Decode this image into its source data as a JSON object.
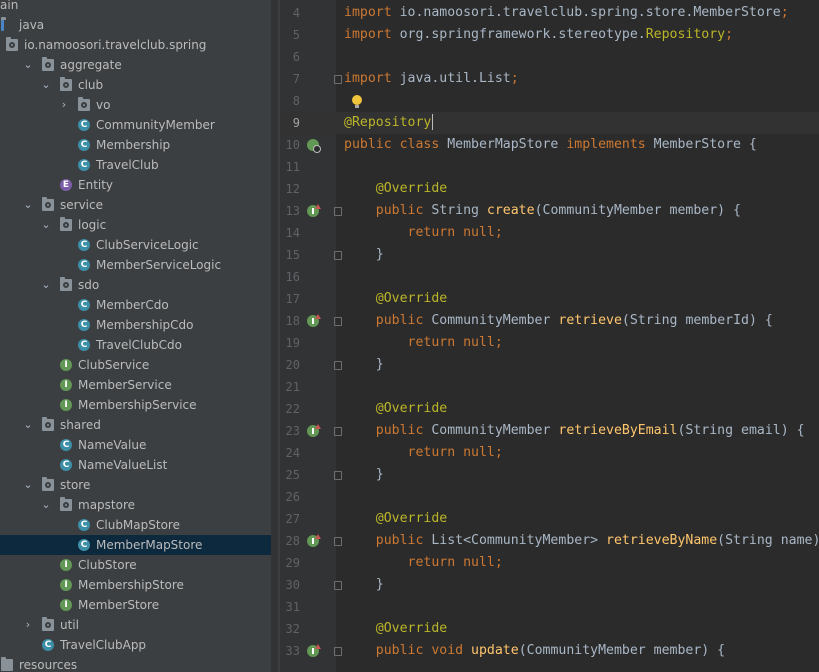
{
  "tree": [
    {
      "label": "ain",
      "depth": 0,
      "arrow": "",
      "icon": ""
    },
    {
      "label": "java",
      "depth": 0,
      "arrow": "",
      "icon": "folder-blue"
    },
    {
      "label": "io.namoosori.travelclub.spring",
      "depth": 0,
      "arrow": "",
      "icon": "package"
    },
    {
      "label": "aggregate",
      "depth": 1,
      "arrow": "down",
      "icon": "package"
    },
    {
      "label": "club",
      "depth": 2,
      "arrow": "down",
      "icon": "package"
    },
    {
      "label": "vo",
      "depth": 3,
      "arrow": "right",
      "icon": "package"
    },
    {
      "label": "CommunityMember",
      "depth": 3,
      "arrow": "",
      "icon": "class"
    },
    {
      "label": "Membership",
      "depth": 3,
      "arrow": "",
      "icon": "class"
    },
    {
      "label": "TravelClub",
      "depth": 3,
      "arrow": "",
      "icon": "class"
    },
    {
      "label": "Entity",
      "depth": 2,
      "arrow": "",
      "icon": "interface-e"
    },
    {
      "label": "service",
      "depth": 1,
      "arrow": "down",
      "icon": "package"
    },
    {
      "label": "logic",
      "depth": 2,
      "arrow": "down",
      "icon": "package"
    },
    {
      "label": "ClubServiceLogic",
      "depth": 3,
      "arrow": "",
      "icon": "class"
    },
    {
      "label": "MemberServiceLogic",
      "depth": 3,
      "arrow": "",
      "icon": "class"
    },
    {
      "label": "sdo",
      "depth": 2,
      "arrow": "down",
      "icon": "package"
    },
    {
      "label": "MemberCdo",
      "depth": 3,
      "arrow": "",
      "icon": "class"
    },
    {
      "label": "MembershipCdo",
      "depth": 3,
      "arrow": "",
      "icon": "class"
    },
    {
      "label": "TravelClubCdo",
      "depth": 3,
      "arrow": "",
      "icon": "class"
    },
    {
      "label": "ClubService",
      "depth": 2,
      "arrow": "",
      "icon": "interface"
    },
    {
      "label": "MemberService",
      "depth": 2,
      "arrow": "",
      "icon": "interface"
    },
    {
      "label": "MembershipService",
      "depth": 2,
      "arrow": "",
      "icon": "interface"
    },
    {
      "label": "shared",
      "depth": 1,
      "arrow": "down",
      "icon": "package"
    },
    {
      "label": "NameValue",
      "depth": 2,
      "arrow": "",
      "icon": "class"
    },
    {
      "label": "NameValueList",
      "depth": 2,
      "arrow": "",
      "icon": "class"
    },
    {
      "label": "store",
      "depth": 1,
      "arrow": "down",
      "icon": "package"
    },
    {
      "label": "mapstore",
      "depth": 2,
      "arrow": "down",
      "icon": "package"
    },
    {
      "label": "ClubMapStore",
      "depth": 3,
      "arrow": "",
      "icon": "class"
    },
    {
      "label": "MemberMapStore",
      "depth": 3,
      "arrow": "",
      "icon": "class",
      "selected": true
    },
    {
      "label": "ClubStore",
      "depth": 2,
      "arrow": "",
      "icon": "interface"
    },
    {
      "label": "MembershipStore",
      "depth": 2,
      "arrow": "",
      "icon": "interface"
    },
    {
      "label": "MemberStore",
      "depth": 2,
      "arrow": "",
      "icon": "interface"
    },
    {
      "label": "util",
      "depth": 1,
      "arrow": "right",
      "icon": "package"
    },
    {
      "label": "TravelClubApp",
      "depth": 1,
      "arrow": "",
      "icon": "class"
    },
    {
      "label": "resources",
      "depth": 0,
      "arrow": "",
      "icon": "folder"
    }
  ],
  "editor": {
    "current_line": "9",
    "lines": [
      {
        "n": "4",
        "seg": [
          [
            "kw",
            "import "
          ],
          [
            "pl",
            "io.namoosori.travelclub.spring.store.MemberStore"
          ],
          [
            "kw",
            ";"
          ]
        ]
      },
      {
        "n": "5",
        "seg": [
          [
            "kw",
            "import "
          ],
          [
            "pl",
            "org.springframework.stereotype."
          ],
          [
            "an",
            "Repository"
          ],
          [
            "kw",
            ";"
          ]
        ]
      },
      {
        "n": "6",
        "seg": []
      },
      {
        "n": "7",
        "seg": [
          [
            "kw",
            "import "
          ],
          [
            "pl",
            "java.util.List"
          ],
          [
            "kw",
            ";"
          ]
        ],
        "fold": true
      },
      {
        "n": "8",
        "seg": []
      },
      {
        "n": "9",
        "seg": [
          [
            "an",
            "@Repository"
          ]
        ],
        "caret": true
      },
      {
        "n": "10",
        "seg": [
          [
            "kw",
            "public class "
          ],
          [
            "pl",
            "MemberMapStore "
          ],
          [
            "kw",
            "implements "
          ],
          [
            "pl",
            "MemberStore {"
          ]
        ],
        "marker": "bean"
      },
      {
        "n": "11",
        "seg": []
      },
      {
        "n": "12",
        "seg": [
          [
            "pl",
            "    "
          ],
          [
            "an",
            "@Override"
          ]
        ]
      },
      {
        "n": "13",
        "seg": [
          [
            "pl",
            "    "
          ],
          [
            "kw",
            "public "
          ],
          [
            "pl",
            "String "
          ],
          [
            "fn",
            "create"
          ],
          [
            "pl",
            "(CommunityMember member) {"
          ]
        ],
        "marker": "override",
        "fold": true
      },
      {
        "n": "14",
        "seg": [
          [
            "pl",
            "        "
          ],
          [
            "kw",
            "return null;"
          ]
        ]
      },
      {
        "n": "15",
        "seg": [
          [
            "pl",
            "    }"
          ]
        ],
        "fold": true
      },
      {
        "n": "16",
        "seg": []
      },
      {
        "n": "17",
        "seg": [
          [
            "pl",
            "    "
          ],
          [
            "an",
            "@Override"
          ]
        ]
      },
      {
        "n": "18",
        "seg": [
          [
            "pl",
            "    "
          ],
          [
            "kw",
            "public "
          ],
          [
            "pl",
            "CommunityMember "
          ],
          [
            "fn",
            "retrieve"
          ],
          [
            "pl",
            "(String memberId) {"
          ]
        ],
        "marker": "override",
        "fold": true
      },
      {
        "n": "19",
        "seg": [
          [
            "pl",
            "        "
          ],
          [
            "kw",
            "return null;"
          ]
        ]
      },
      {
        "n": "20",
        "seg": [
          [
            "pl",
            "    }"
          ]
        ],
        "fold": true
      },
      {
        "n": "21",
        "seg": []
      },
      {
        "n": "22",
        "seg": [
          [
            "pl",
            "    "
          ],
          [
            "an",
            "@Override"
          ]
        ]
      },
      {
        "n": "23",
        "seg": [
          [
            "pl",
            "    "
          ],
          [
            "kw",
            "public "
          ],
          [
            "pl",
            "CommunityMember "
          ],
          [
            "fn",
            "retrieveByEmail"
          ],
          [
            "pl",
            "(String email) {"
          ]
        ],
        "marker": "override",
        "fold": true
      },
      {
        "n": "24",
        "seg": [
          [
            "pl",
            "        "
          ],
          [
            "kw",
            "return null;"
          ]
        ]
      },
      {
        "n": "25",
        "seg": [
          [
            "pl",
            "    }"
          ]
        ],
        "fold": true
      },
      {
        "n": "26",
        "seg": []
      },
      {
        "n": "27",
        "seg": [
          [
            "pl",
            "    "
          ],
          [
            "an",
            "@Override"
          ]
        ]
      },
      {
        "n": "28",
        "seg": [
          [
            "pl",
            "    "
          ],
          [
            "kw",
            "public "
          ],
          [
            "pl",
            "List<CommunityMember> "
          ],
          [
            "fn",
            "retrieveByName"
          ],
          [
            "pl",
            "(String name)"
          ]
        ],
        "marker": "override",
        "fold": true
      },
      {
        "n": "29",
        "seg": [
          [
            "pl",
            "        "
          ],
          [
            "kw",
            "return null;"
          ]
        ]
      },
      {
        "n": "30",
        "seg": [
          [
            "pl",
            "    }"
          ]
        ],
        "fold": true
      },
      {
        "n": "31",
        "seg": []
      },
      {
        "n": "32",
        "seg": [
          [
            "pl",
            "    "
          ],
          [
            "an",
            "@Override"
          ]
        ]
      },
      {
        "n": "33",
        "seg": [
          [
            "pl",
            "    "
          ],
          [
            "kw",
            "public void "
          ],
          [
            "fn",
            "update"
          ],
          [
            "pl",
            "(CommunityMember member) {"
          ]
        ],
        "marker": "override",
        "fold": true
      }
    ]
  },
  "colors": {
    "background": "#2b2b2b",
    "sidebar": "#3c3f41",
    "keyword": "#cc7832",
    "annotation": "#bbb529",
    "method": "#ffc66d",
    "plain": "#a9b7c6",
    "selection": "#0d293e"
  }
}
